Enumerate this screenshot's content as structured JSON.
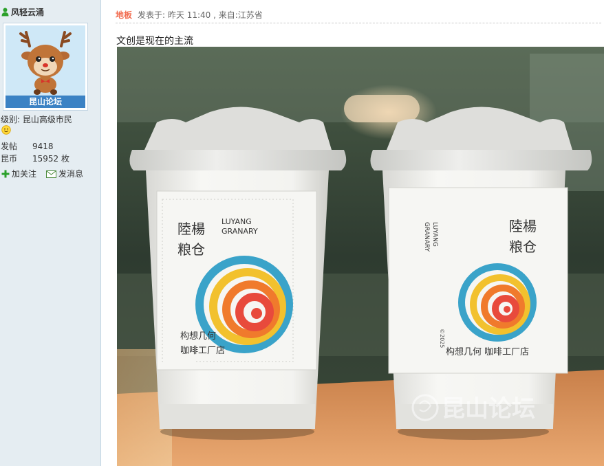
{
  "author": {
    "username": "风轻云涌",
    "forum_badge": "昆山论坛",
    "level_label": "级别:",
    "level_value": "昆山高级市民",
    "stats": [
      {
        "key": "发帖",
        "value": "9418"
      },
      {
        "key": "昆币",
        "value": "15952 枚"
      }
    ],
    "actions": {
      "follow": "加关注",
      "message": "发消息"
    }
  },
  "post": {
    "floor": "地板",
    "meta": "发表于: 昨天 11:40 , 来自:江苏省",
    "text": "文创是现在的主流"
  },
  "image": {
    "cup_left": {
      "brand_cn_1": "陸楊",
      "brand_cn_2": "粮仓",
      "brand_en_1": "LUYANG",
      "brand_en_2": "GRANARY",
      "tagline_1": "构想几何",
      "tagline_2": "咖啡工厂店"
    },
    "cup_right": {
      "brand_cn_1": "陸楊",
      "brand_cn_2": "粮仓",
      "brand_en_1": "LUYANG",
      "brand_en_2": "GRANARY",
      "year": "©2025",
      "tagline": "构想几何 咖啡工厂店"
    },
    "watermark": "昆山论坛"
  },
  "colors": {
    "sidebar_bg": "#e5edf2",
    "floor_accent": "#f26c4f",
    "badge_blue": "#3b82c4"
  }
}
